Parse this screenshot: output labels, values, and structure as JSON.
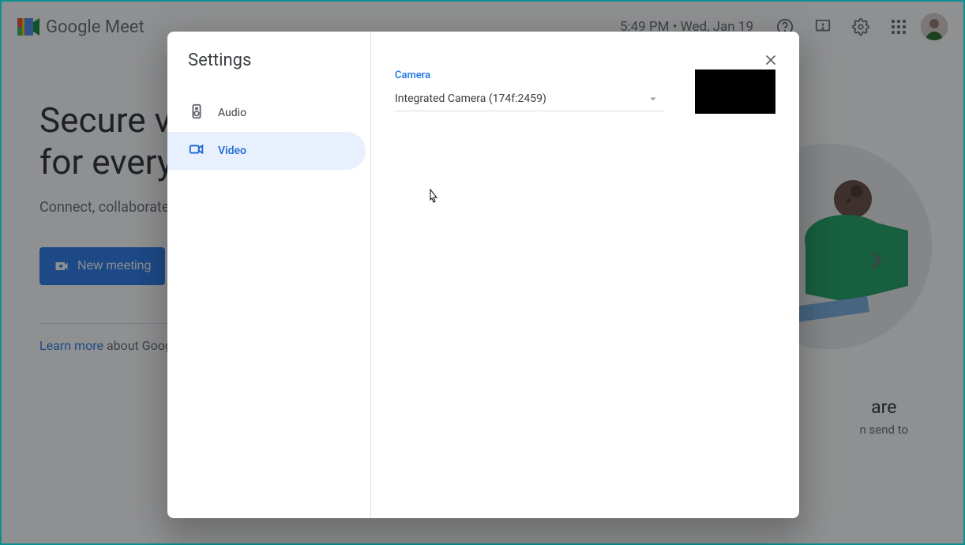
{
  "header": {
    "brand": "Google Meet",
    "clock": "5:49 PM • Wed, Jan 19"
  },
  "landing": {
    "headline_line1": "Secure video conferencing",
    "headline_line2": "for everyone",
    "subtext": "Connect, collaborate, and celebrate from anywhere with Google Meet",
    "new_meeting": "New meeting",
    "learn_more": "Learn more",
    "learn_suffix": " about Google Meet",
    "promo_title_tail": "are",
    "promo_sub_tail": "n send to"
  },
  "dialog": {
    "title": "Settings",
    "tabs": {
      "audio": "Audio",
      "video": "Video"
    },
    "camera": {
      "label": "Camera",
      "value": "Integrated Camera (174f:2459)"
    }
  }
}
